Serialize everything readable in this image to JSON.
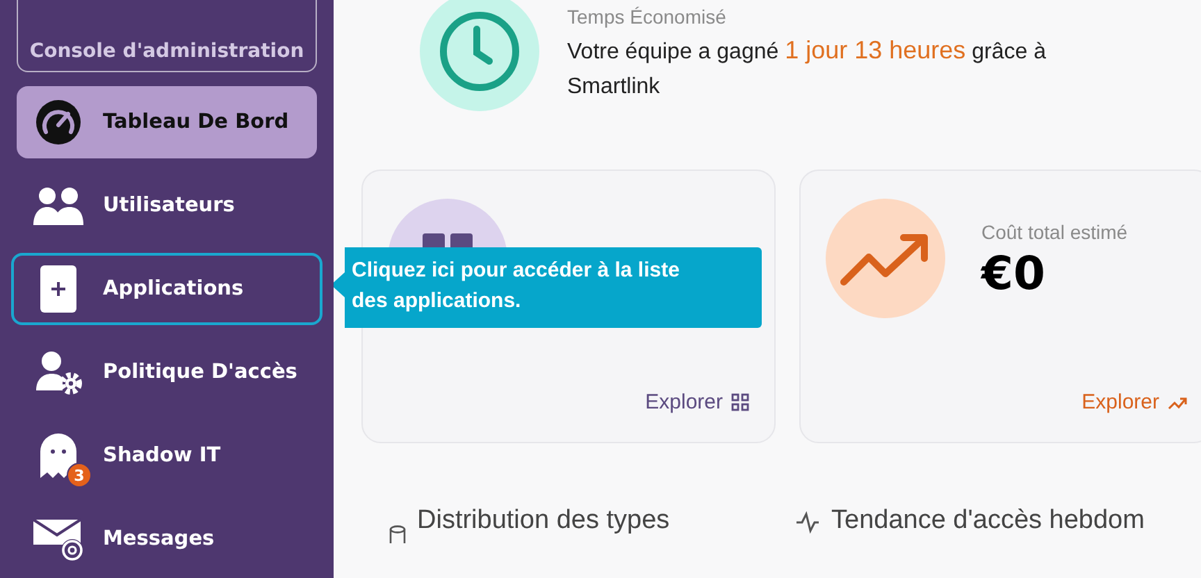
{
  "sidebar": {
    "console_button": "Console d'administration",
    "items": [
      {
        "kind": "gauge",
        "label": "Tableau De Bord",
        "selected": true,
        "highlighted": false
      },
      {
        "kind": "users",
        "label": "Utilisateurs",
        "selected": false,
        "highlighted": false
      },
      {
        "kind": "app",
        "label": "Applications",
        "selected": false,
        "highlighted": true
      },
      {
        "kind": "user-gear",
        "label": "Politique D'accès",
        "selected": false,
        "highlighted": false
      },
      {
        "kind": "ghost",
        "label": "Shadow IT",
        "selected": false,
        "highlighted": false,
        "badge": "3"
      },
      {
        "kind": "mail",
        "label": "Messages",
        "selected": false,
        "highlighted": false
      }
    ]
  },
  "tour_tooltip": {
    "text": "Cliquez ici pour accéder à la liste des applications."
  },
  "time_saved": {
    "label": "Temps Économisé",
    "text_start": "Votre équipe a gagné",
    "highlight": "1 jour 13 heures",
    "text_end": "grâce à Smartlink"
  },
  "cards": [
    {
      "kind": "apps",
      "link": "Explorer"
    },
    {
      "kind": "cost",
      "label": "Coût total estimé",
      "value": "€0",
      "link": "Explorer"
    }
  ],
  "sections": [
    {
      "kind": "database",
      "title": "Distribution des types"
    },
    {
      "kind": "activity",
      "title": "Tendance d'accès hebdom"
    }
  ]
}
